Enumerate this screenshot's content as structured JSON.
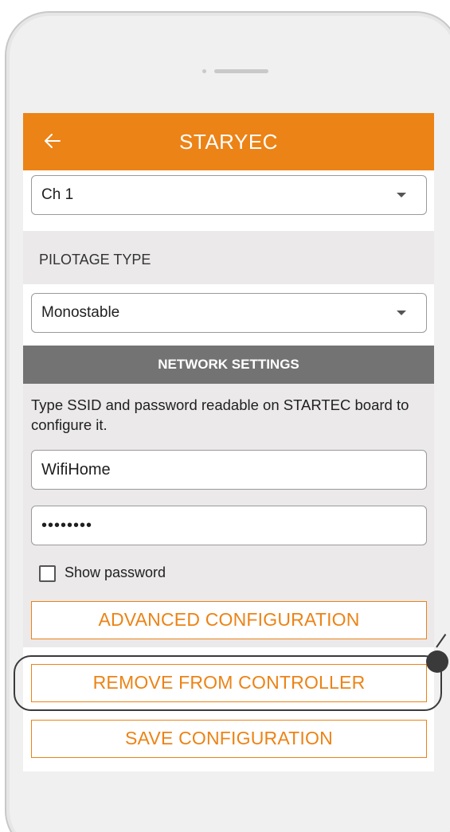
{
  "app": {
    "title": "STARYEC"
  },
  "channel_select": {
    "value": "Ch 1"
  },
  "pilotage": {
    "label": "PILOTAGE TYPE",
    "value": "Monostable"
  },
  "network": {
    "header": "NETWORK SETTINGS",
    "hint": "Type SSID and password readable on STARTEC board to configure it.",
    "ssid": "WifiHome",
    "password_masked": "••••••••",
    "show_password_label": "Show password",
    "show_password_checked": false
  },
  "buttons": {
    "advanced": "ADVANCED CONFIGURATION",
    "remove": "REMOVE FROM CONTROLLER",
    "save": "SAVE CONFIGURATION"
  },
  "colors": {
    "accent": "#ec8316",
    "section_header": "#737373",
    "background": "#ebe9ea"
  }
}
